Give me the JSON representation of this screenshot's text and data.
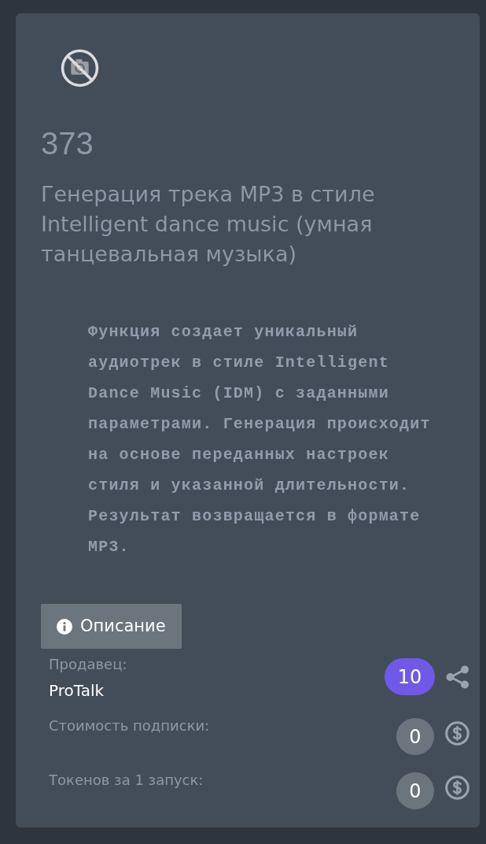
{
  "number": "373",
  "title": "Генерация трека MP3 в стиле Intelligent dance music (умная танцевальная музыка)",
  "description": "Функция создает уникальный аудиотрек в стиле Intelligent Dance Music (IDM) с заданными параметрами. Генерация происходит на основе переданных настроек стиля и указанной длительности. Результат возвращается в формате MP3.",
  "description_button": {
    "label": "Описание"
  },
  "seller": {
    "label": "Продавец:",
    "name": "ProTalk",
    "count": "10"
  },
  "prices": [
    {
      "label": "Стоимость подписки:",
      "value": "0"
    },
    {
      "label": "Токенов за 1 запуск:",
      "value": "0"
    }
  ]
}
